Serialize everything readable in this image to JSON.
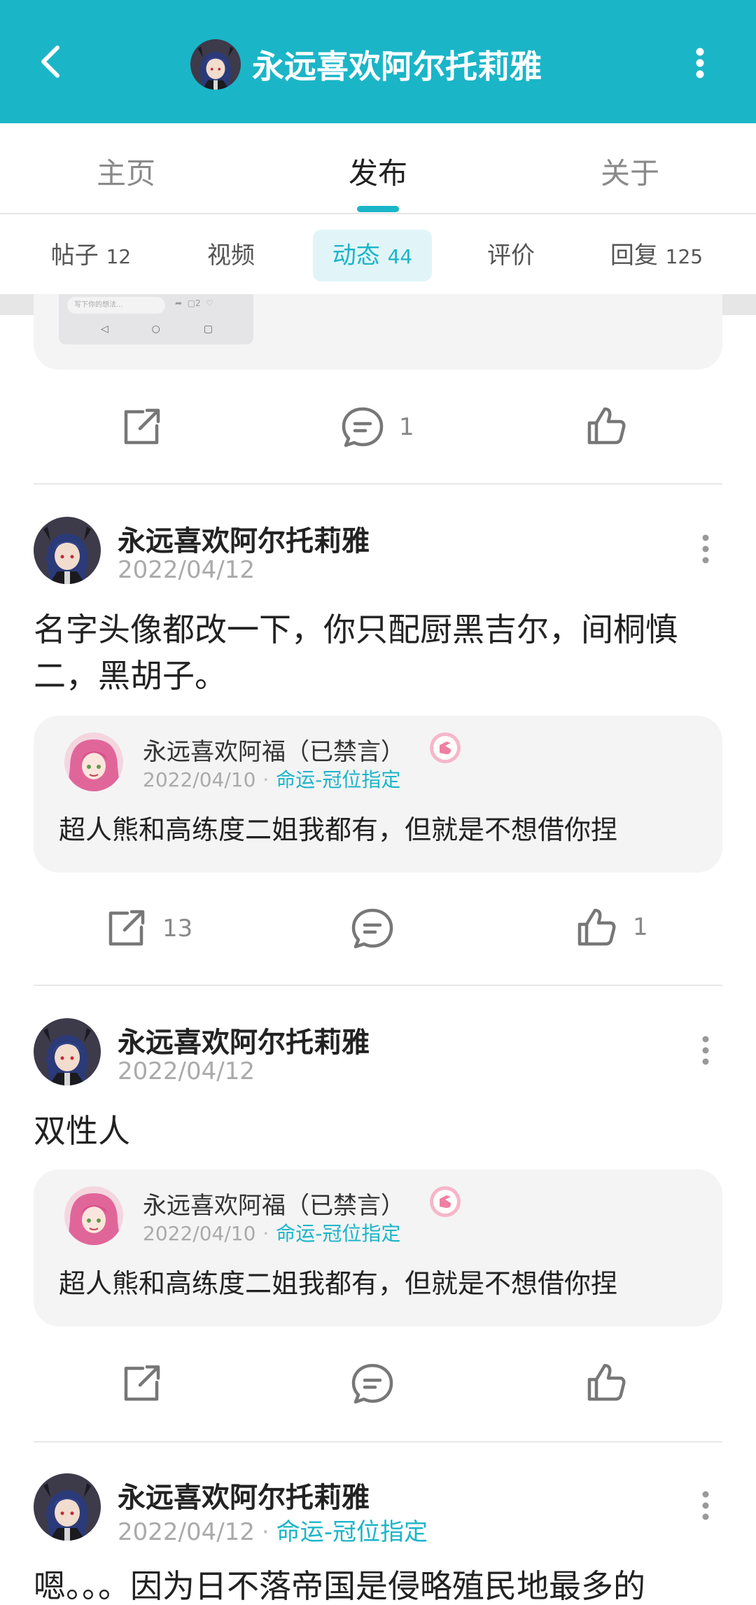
{
  "header": {
    "title": "永远喜欢阿尔托莉雅",
    "back_icon": "back-arrow-icon",
    "more_icon": "more-vertical-icon",
    "bg_color": "#1bb5c8"
  },
  "main_tabs": [
    {
      "label": "主页"
    },
    {
      "label": "发布"
    },
    {
      "label": "关于"
    }
  ],
  "active_main_tab": "发布",
  "sub_tabs": [
    {
      "label": "帖子",
      "count": "12"
    },
    {
      "label": "视频",
      "count": ""
    },
    {
      "label": "动态",
      "count": "44"
    },
    {
      "label": "评价",
      "count": ""
    },
    {
      "label": "回复",
      "count": "125"
    }
  ],
  "active_sub_tab": "动态",
  "partial_post": {
    "thumb_input_placeholder": "写下你的想法...",
    "thumb_comment_count": "2",
    "comment_count": "1"
  },
  "posts": [
    {
      "author": "永远喜欢阿尔托莉雅",
      "date": "2022/04/12",
      "tag": "",
      "content": "名字头像都改一下，你只配厨黑吉尔，间桐慎二，黑胡子。",
      "quote": {
        "author": "永远喜欢阿福（已禁言）",
        "date": "2022/04/10",
        "tag": "命运-冠位指定",
        "text": "超人熊和高练度二姐我都有，但就是不想借你捏"
      },
      "share_count": "13",
      "comment_count": "",
      "like_count": "1"
    },
    {
      "author": "永远喜欢阿尔托莉雅",
      "date": "2022/04/12",
      "tag": "",
      "content": "双性人",
      "quote": {
        "author": "永远喜欢阿福（已禁言）",
        "date": "2022/04/10",
        "tag": "命运-冠位指定",
        "text": "超人熊和高练度二姐我都有，但就是不想借你捏"
      },
      "share_count": "",
      "comment_count": "",
      "like_count": ""
    },
    {
      "author": "永远喜欢阿尔托莉雅",
      "date": "2022/04/12",
      "tag": "命运-冠位指定",
      "content": "嗯。。。因为日不落帝国是侵略殖民地最多的"
    }
  ],
  "accent_color": "#1bb5c8"
}
